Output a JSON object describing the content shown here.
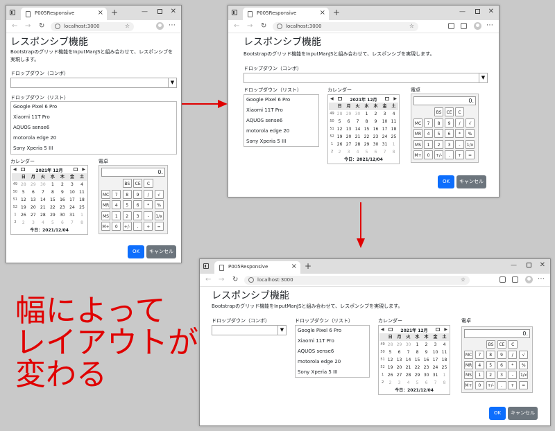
{
  "browser": {
    "tab_title": "P005Responsive",
    "tab_close": "×",
    "new_tab": "+",
    "url": "localhost:3000",
    "icons": [
      "tab-strip-icon",
      "favicon-icon",
      "back-arrow-icon",
      "forward-arrow-icon",
      "reload-icon",
      "info-icon",
      "favorite-star-icon",
      "profile-avatar-icon",
      "more-menu-icon"
    ]
  },
  "page": {
    "title": "レスポンシブ機能",
    "description": "Bootstrapのグリッド機能をInputManJSと組み合わせて、レスポンシブを実現します。",
    "dropdown_combo_label": "ドロップダウン（コンボ）",
    "dropdown_combo_value": "",
    "dropdown_list_label": "ドロップダウン（リスト）",
    "list_items": [
      "Google Pixel 6 Pro",
      "Xiaomi 11T Pro",
      "AQUOS sense6",
      "motorola edge 20",
      "Sony Xperia 5 III"
    ],
    "calendar_label": "カレンダー",
    "calculator_label": "電卓",
    "ok_label": "OK",
    "cancel_label": "キャンセル"
  },
  "calendar": {
    "prev": "◀",
    "next": "▶",
    "month": "2021年 12月",
    "weekdays": [
      "",
      "日",
      "月",
      "火",
      "水",
      "木",
      "金",
      "土"
    ],
    "weeks": [
      {
        "wk": "49",
        "days": [
          {
            "d": "28",
            "o": true
          },
          {
            "d": "29",
            "o": true
          },
          {
            "d": "30",
            "o": true
          },
          {
            "d": "1"
          },
          {
            "d": "2"
          },
          {
            "d": "3"
          },
          {
            "d": "4"
          }
        ]
      },
      {
        "wk": "50",
        "days": [
          {
            "d": "5"
          },
          {
            "d": "6"
          },
          {
            "d": "7"
          },
          {
            "d": "8"
          },
          {
            "d": "9"
          },
          {
            "d": "10"
          },
          {
            "d": "11"
          }
        ]
      },
      {
        "wk": "51",
        "days": [
          {
            "d": "12"
          },
          {
            "d": "13"
          },
          {
            "d": "14"
          },
          {
            "d": "15"
          },
          {
            "d": "16"
          },
          {
            "d": "17"
          },
          {
            "d": "18"
          }
        ]
      },
      {
        "wk": "52",
        "days": [
          {
            "d": "19"
          },
          {
            "d": "20"
          },
          {
            "d": "21"
          },
          {
            "d": "22"
          },
          {
            "d": "23"
          },
          {
            "d": "24"
          },
          {
            "d": "25"
          }
        ]
      },
      {
        "wk": "1",
        "days": [
          {
            "d": "26"
          },
          {
            "d": "27"
          },
          {
            "d": "28"
          },
          {
            "d": "29"
          },
          {
            "d": "30"
          },
          {
            "d": "31"
          },
          {
            "d": "1",
            "o": true
          }
        ]
      },
      {
        "wk": "2",
        "days": [
          {
            "d": "2",
            "o": true
          },
          {
            "d": "3",
            "o": true
          },
          {
            "d": "4",
            "o": true
          },
          {
            "d": "5",
            "o": true
          },
          {
            "d": "6",
            "o": true
          },
          {
            "d": "7",
            "o": true
          },
          {
            "d": "8",
            "o": true
          }
        ]
      }
    ],
    "today": "今日：2021/12/04"
  },
  "calculator": {
    "display": "0.",
    "rows": [
      [
        "",
        "BS",
        "CE",
        "C"
      ],
      [
        "MC",
        "7",
        "8",
        "9",
        "/",
        "√"
      ],
      [
        "MR",
        "4",
        "5",
        "6",
        "*",
        "%"
      ],
      [
        "MS",
        "1",
        "2",
        "3",
        "-",
        "1/x"
      ],
      [
        "M+",
        "0",
        "+/-",
        ".",
        "+",
        "="
      ]
    ]
  },
  "caption": "幅によって\nレイアウトが\n変わる",
  "colors": {
    "arrow": "#e00000",
    "primary": "#0d6efd",
    "secondary": "#6c757d"
  }
}
